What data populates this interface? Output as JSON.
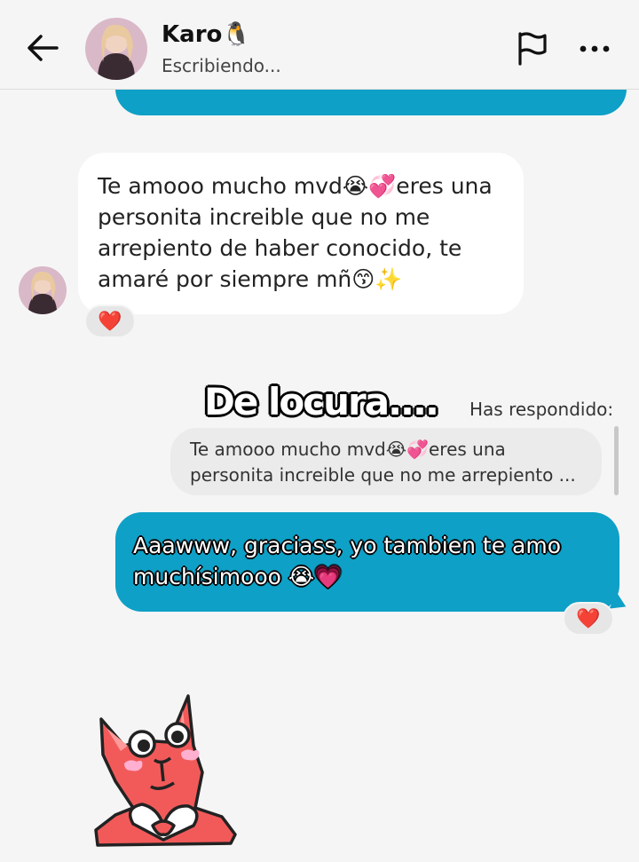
{
  "header": {
    "contact_name": "Karo🐧",
    "status": "Escribiendo..."
  },
  "messages": {
    "incoming_text": "Te amooo mucho mvd😭💞eres una personita increible que no me arrepiento de haber conocido, te amaré por siempre mñ😙✨",
    "incoming_reaction": "❤️",
    "replied_label": "Has respondido:",
    "quoted_text": "Te amooo mucho mvd😭💞eres una personita increible que no me arrepiento ...",
    "outgoing_text": "Aaawww, graciass, yo tambien te amo muchísimooo 😭💗",
    "outgoing_reaction": "❤️"
  },
  "overlay_caption": "De locura....",
  "colors": {
    "background": "#f5f5f5",
    "outgoing_bubble": "#0ea0c6",
    "incoming_bubble": "#ffffff",
    "reaction_pill": "#e6e6e6"
  },
  "icons": [
    "back-arrow-icon",
    "flag-icon",
    "more-options-icon",
    "heart-reaction-icon"
  ]
}
